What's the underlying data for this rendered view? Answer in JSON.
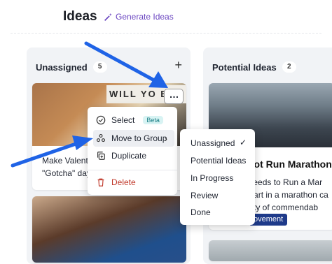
{
  "header": {
    "title": "Ideas",
    "generate_label": "Generate Ideas"
  },
  "columns": [
    {
      "title": "Unassigned",
      "count": "5",
      "add_icon": "plus-icon"
    },
    {
      "title": "Potential Ideas",
      "count": "2"
    }
  ],
  "cards": {
    "dog_card": {
      "sign_text": "WILL YO BE M",
      "text_line1": "Make Valentin",
      "text_line2": "\"Gotcha\" day!"
    },
    "race_card": {
      "title": "o Not Run Marathon",
      "line1": "he Needs to Run a Mar",
      "line2": "ing part in a marathon ca",
      "line3": "variety of commendab",
      "tag": "ovement"
    }
  },
  "context_menu": {
    "items": [
      {
        "label": "Select",
        "badge": "Beta",
        "icon": "check-circle-icon"
      },
      {
        "label": "Move to Group",
        "icon": "group-icon",
        "submenu": true
      },
      {
        "label": "Duplicate",
        "icon": "duplicate-icon"
      },
      {
        "label": "Delete",
        "icon": "trash-icon",
        "danger": true
      }
    ]
  },
  "submenu": {
    "items": [
      {
        "label": "Unassigned",
        "checked": true
      },
      {
        "label": "Potential Ideas"
      },
      {
        "label": "In Progress"
      },
      {
        "label": "Review"
      },
      {
        "label": "Done"
      }
    ]
  },
  "colors": {
    "accent": "#6b46c1",
    "arrow": "#1f63e6",
    "danger": "#c0392b",
    "tag": "#1e3a8a"
  }
}
